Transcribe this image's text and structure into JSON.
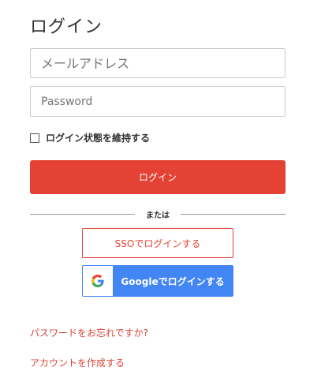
{
  "page": {
    "title": "ログイン"
  },
  "form": {
    "email_placeholder": "メールアドレス",
    "email_value": "",
    "password_placeholder": "Password",
    "password_value": "",
    "remember_label": "ログイン状態を維持する",
    "remember_checked": false,
    "login_button": "ログイン"
  },
  "divider": {
    "label": "または"
  },
  "sso": {
    "sso_button": "SSOでログインする",
    "google_button": "Googleでログインする",
    "google_icon": "google-g-icon"
  },
  "links": {
    "forgot_password": "パスワードをお忘れですか?",
    "create_account": "アカウントを作成する"
  },
  "colors": {
    "accent": "#e44235",
    "google_blue": "#4285f4",
    "link": "#d9453a"
  }
}
